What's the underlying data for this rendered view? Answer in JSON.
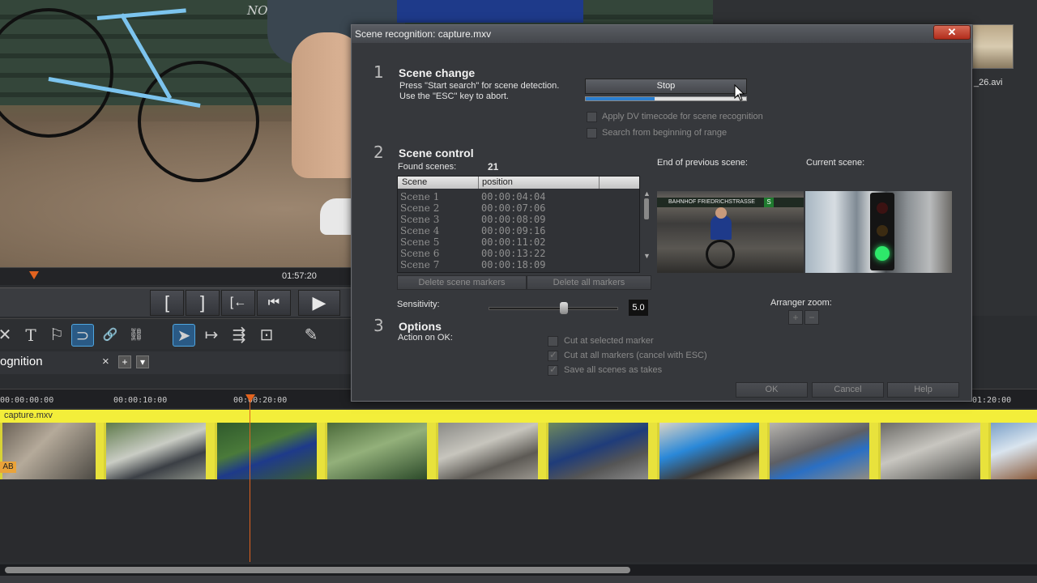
{
  "background": {
    "bench_text": "NOT a public bench",
    "preview_time": "01:57:20",
    "right_clip_name": "_26.avi"
  },
  "transport": {
    "mark_in": "[",
    "mark_out": "]",
    "go_in": "[←",
    "prev": "⏮",
    "play": "▶"
  },
  "toolbar": {
    "tools": [
      "✕",
      "T",
      "⚐",
      "⊃",
      "🔗",
      "⛓",
      "➤",
      "↦",
      "⇶",
      "⊡",
      "✎"
    ]
  },
  "tab": {
    "title": "ognition",
    "close": "×",
    "plus": "+",
    "down": "▾"
  },
  "timeline": {
    "ruler_ticks": [
      "00:00:00:00",
      "00:00:10:00",
      "00:00:20:00",
      "01:20:00"
    ],
    "track_name": "capture.mxv",
    "ab_label": "AB"
  },
  "dialog": {
    "title": "Scene recognition: capture.mxv",
    "close": "✕",
    "sections": {
      "scene_change": {
        "number": "1",
        "title": "Scene change",
        "line1": "Press \"Start search\" for scene detection.",
        "line2": "Use the \"ESC\" key to abort.",
        "button": "Stop",
        "progress_fraction": 0.43,
        "opt1": "Apply DV timecode for scene recognition",
        "opt2": "Search from beginning of range"
      },
      "scene_control": {
        "number": "2",
        "title": "Scene control",
        "found_label": "Found scenes:",
        "found_count": "21",
        "col_scene": "Scene",
        "col_position": "position",
        "scenes": [
          {
            "name": "Scene 1",
            "pos": "00:00:04:04"
          },
          {
            "name": "Scene 2",
            "pos": "00:00:07:06"
          },
          {
            "name": "Scene 3",
            "pos": "00:00:08:09"
          },
          {
            "name": "Scene 4",
            "pos": "00:00:09:16"
          },
          {
            "name": "Scene 5",
            "pos": "00:00:11:02"
          },
          {
            "name": "Scene 6",
            "pos": "00:00:13:22"
          },
          {
            "name": "Scene 7",
            "pos": "00:00:18:09"
          }
        ],
        "delete_scene_markers": "Delete scene markers",
        "delete_all_markers": "Delete all markers",
        "end_prev_label": "End of previous scene:",
        "current_label": "Current scene:",
        "prev_scene_sign": "BAHNHOF FRIEDRICHSTRASSE",
        "prev_scene_s": "S",
        "sensitivity_label": "Sensitivity:",
        "sensitivity_value": "5.0",
        "sensitivity_fraction": 0.58,
        "arranger_zoom_label": "Arranger zoom:",
        "zoom_in": "+",
        "zoom_out": "−"
      },
      "options": {
        "number": "3",
        "title": "Options",
        "action_label": "Action on OK:",
        "opt1": "Cut at selected marker",
        "opt2": "Cut at all markers (cancel with ESC)",
        "opt3": "Save all scenes as takes"
      }
    },
    "buttons": {
      "ok": "OK",
      "cancel": "Cancel",
      "help": "Help"
    }
  }
}
